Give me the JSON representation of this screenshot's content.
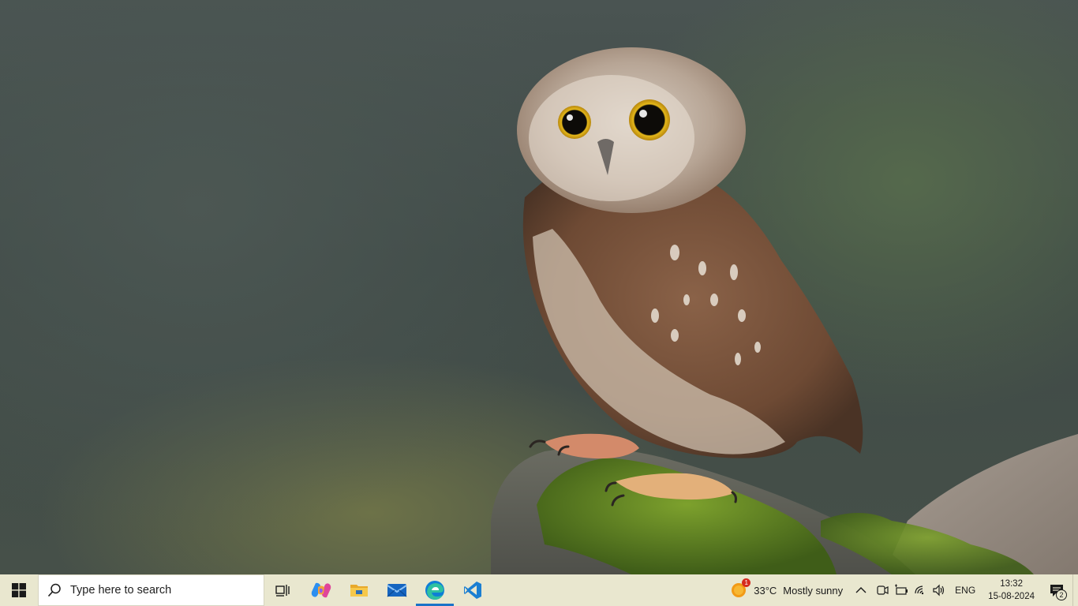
{
  "desktop": {
    "wallpaper": "owl-photo"
  },
  "taskbar": {
    "start_icon": "windows-logo-icon",
    "search": {
      "placeholder": "Type here to search",
      "icon": "search-icon"
    },
    "apps": [
      {
        "name": "task-view",
        "icon": "task-view-icon"
      },
      {
        "name": "copilot",
        "icon": "copilot-icon"
      },
      {
        "name": "file-explorer",
        "icon": "folder-icon"
      },
      {
        "name": "mail",
        "icon": "mail-icon"
      },
      {
        "name": "edge",
        "icon": "edge-icon",
        "active": true
      },
      {
        "name": "vscode",
        "icon": "vscode-icon"
      }
    ],
    "weather": {
      "badge": "1",
      "temperature": "33°C",
      "condition": "Mostly sunny"
    },
    "tray": {
      "language": "ENG",
      "time": "13:32",
      "date": "15-08-2024",
      "notifications": "2"
    },
    "colors": {
      "taskbar_bg": "#e9e7cf",
      "accent": "#1a73c7"
    }
  }
}
